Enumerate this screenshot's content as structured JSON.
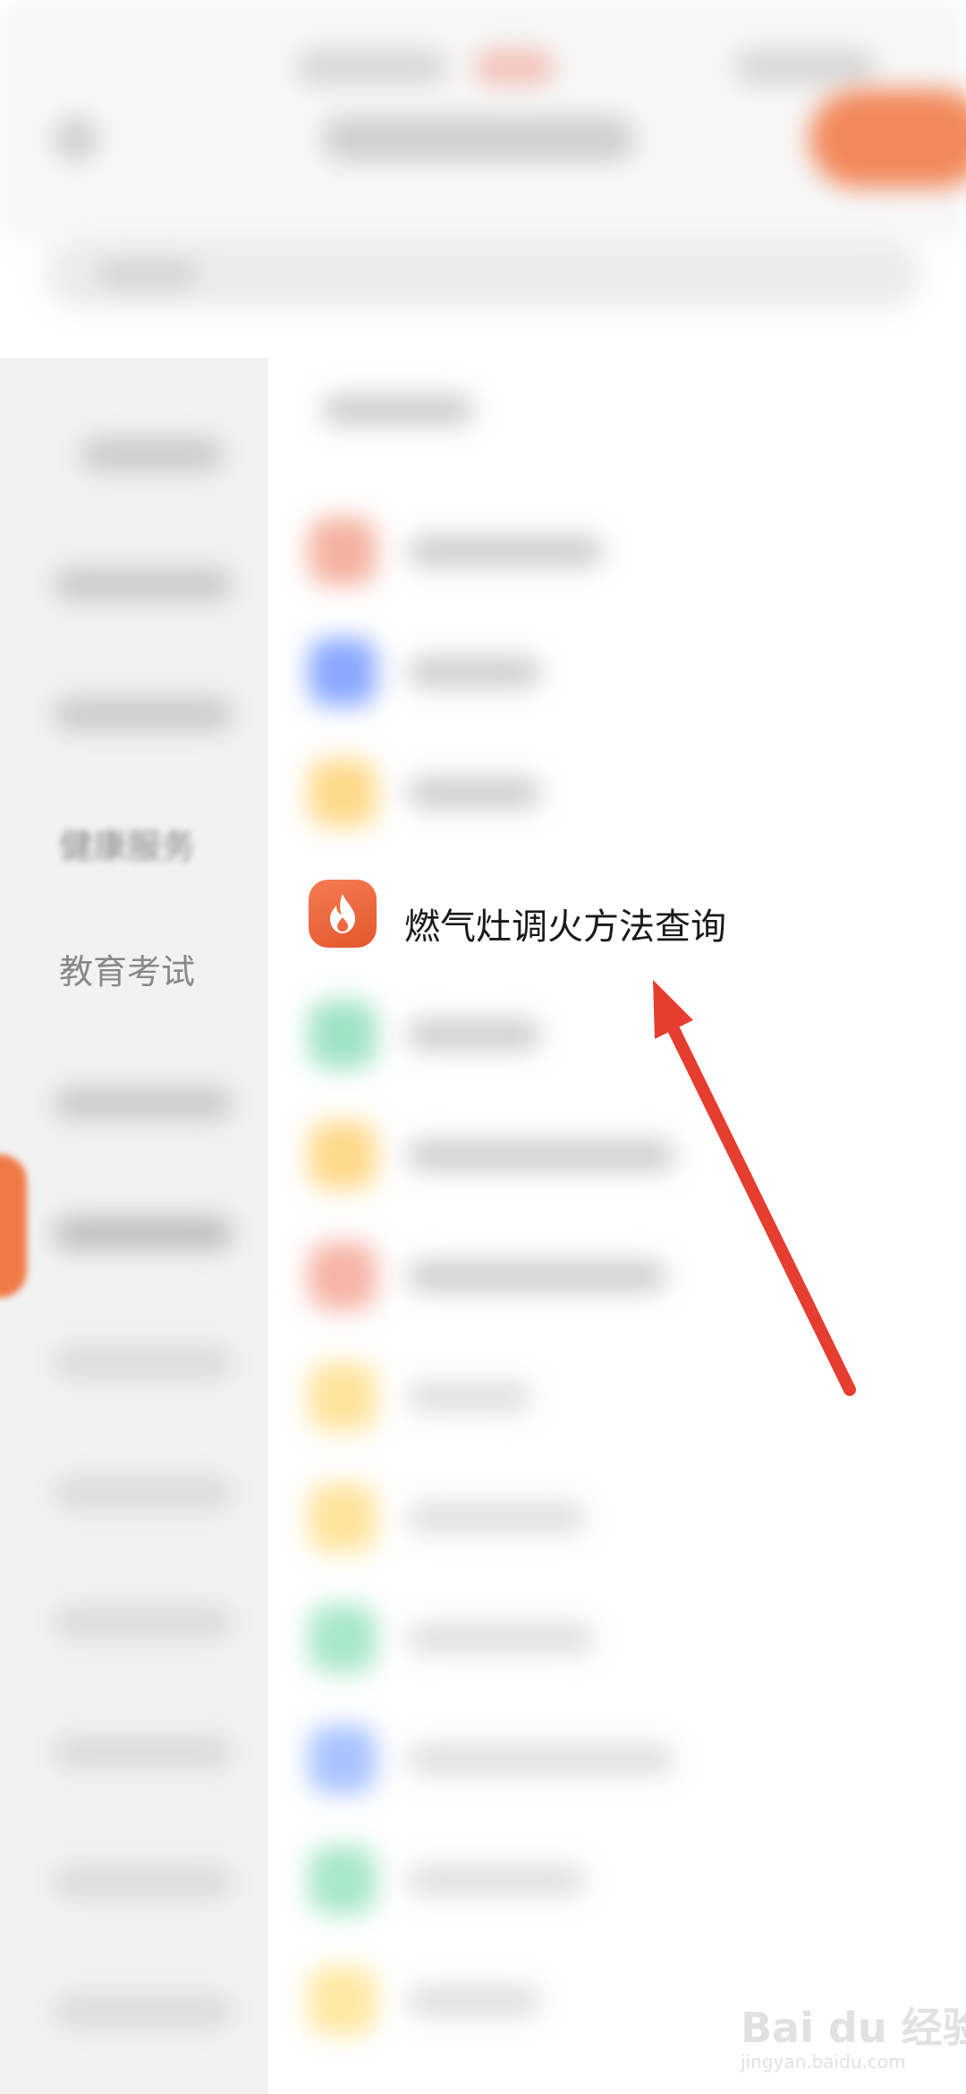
{
  "sidebar": {
    "items": [
      {
        "label": "健康服务"
      },
      {
        "label": "教育考试"
      }
    ]
  },
  "highlighted_item": {
    "label": "燃气灶调火方法查询",
    "icon": "flame-icon",
    "icon_color": "#ef6a40"
  },
  "list_icon_colors": [
    "#f4b2a0",
    "#8aa8ff",
    "#ffd98a",
    "#9fe3c4",
    "#ffd98a",
    "#f6b3a6",
    "#ffe39a",
    "#ffe39a",
    "#a8e8c8",
    "#a9c3ff",
    "#a8e8c8",
    "#ffe8a0"
  ],
  "annotation": {
    "color": "#e53d2f"
  },
  "watermark": {
    "brand": "Bai du 经验",
    "url": "jingyan.baidu.com"
  }
}
